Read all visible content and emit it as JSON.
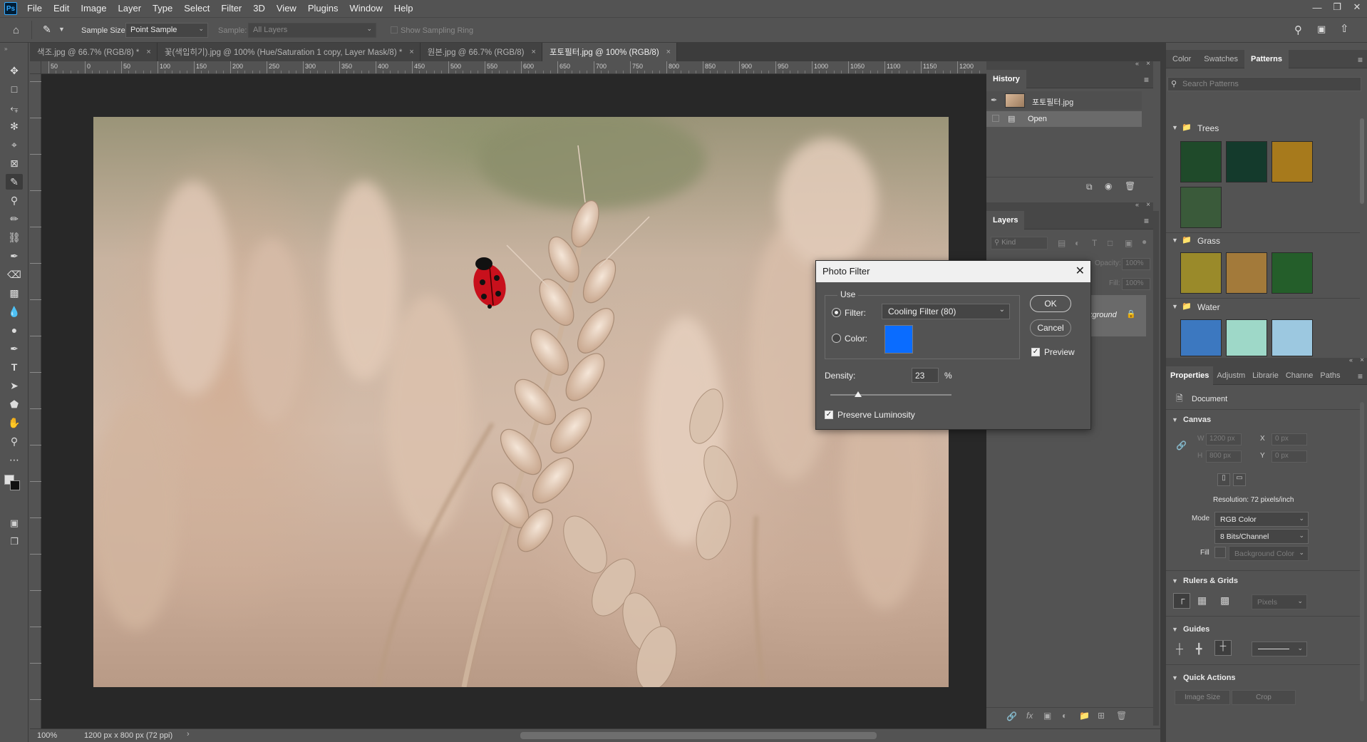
{
  "menubar": {
    "logo": "Ps",
    "items": [
      "File",
      "Edit",
      "Image",
      "Layer",
      "Type",
      "Select",
      "Filter",
      "3D",
      "View",
      "Plugins",
      "Window",
      "Help"
    ]
  },
  "options": {
    "sample_size_label": "Sample Size:",
    "sample_size_value": "Point Sample",
    "sample_label": "Sample:",
    "sample_value": "All Layers",
    "sampling_ring_label": "Show Sampling Ring"
  },
  "tabs": [
    {
      "label": "색조.jpg @ 66.7% (RGB/8) *",
      "active": false
    },
    {
      "label": "꽃(색입히기).jpg @ 100% (Hue/Saturation 1 copy, Layer Mask/8) *",
      "active": false
    },
    {
      "label": "원본.jpg @ 66.7% (RGB/8)",
      "active": false
    },
    {
      "label": "포토필터.jpg @ 100% (RGB/8)",
      "active": true
    }
  ],
  "ruler": {
    "h_ticks": [
      "50",
      "0",
      "50",
      "100",
      "150",
      "200",
      "250",
      "300",
      "350",
      "400",
      "450",
      "500",
      "550",
      "600",
      "650",
      "700",
      "750",
      "800",
      "850",
      "900",
      "950",
      "1000",
      "1050",
      "1100",
      "1150",
      "1200"
    ]
  },
  "status": {
    "zoom": "100%",
    "doc_info": "1200 px x 800 px (72 ppi)"
  },
  "history": {
    "title": "History",
    "snapshot_label": "포토필터.jpg",
    "items": [
      "Open"
    ]
  },
  "layers": {
    "title": "Layers",
    "kind_placeholder": "Kind",
    "opacity_label": "Opacity:",
    "opacity_value": "100%",
    "fill_label": "Fill:",
    "fill_value": "100%",
    "layer_name": "Background"
  },
  "patterns": {
    "tabs": [
      "Color",
      "Swatches",
      "Patterns"
    ],
    "search_placeholder": "Search Patterns",
    "groups": [
      {
        "name": "Trees",
        "colors": [
          "#1f4a2a",
          "#143a2c",
          "#a77a1c",
          "#3a5a3a"
        ]
      },
      {
        "name": "Grass",
        "colors": [
          "#9a8a2a",
          "#a37a3a",
          "#245e2a"
        ]
      },
      {
        "name": "Water",
        "colors": [
          "#3c78c0",
          "#9ed8c8",
          "#9cc8e0"
        ]
      }
    ]
  },
  "properties": {
    "tabs": [
      "Properties",
      "Adjustm",
      "Librarie",
      "Channe",
      "Paths"
    ],
    "doc_label": "Document",
    "canvas_title": "Canvas",
    "w_label": "W",
    "w_value": "1200 px",
    "h_label": "H",
    "h_value": "800 px",
    "x_label": "X",
    "x_value": "0 px",
    "y_label": "Y",
    "y_value": "0 px",
    "resolution": "Resolution: 72 pixels/inch",
    "mode_label": "Mode",
    "mode_value": "RGB Color",
    "depth_value": "8 Bits/Channel",
    "fill_label": "Fill",
    "fill_value": "Background Color",
    "rulers_title": "Rulers & Grids",
    "units_value": "Pixels",
    "guides_title": "Guides",
    "quick_title": "Quick Actions",
    "image_size_btn": "Image Size",
    "crop_btn": "Crop"
  },
  "dialog": {
    "title": "Photo Filter",
    "use_label": "Use",
    "filter_label": "Filter:",
    "filter_value": "Cooling Filter (80)",
    "color_label": "Color:",
    "color_swatch": "#0a6cff",
    "density_label": "Density:",
    "density_value": "23",
    "density_unit": "%",
    "density_fraction": 0.23,
    "preserve_label": "Preserve Luminosity",
    "ok": "OK",
    "cancel": "Cancel",
    "preview_label": "Preview"
  }
}
